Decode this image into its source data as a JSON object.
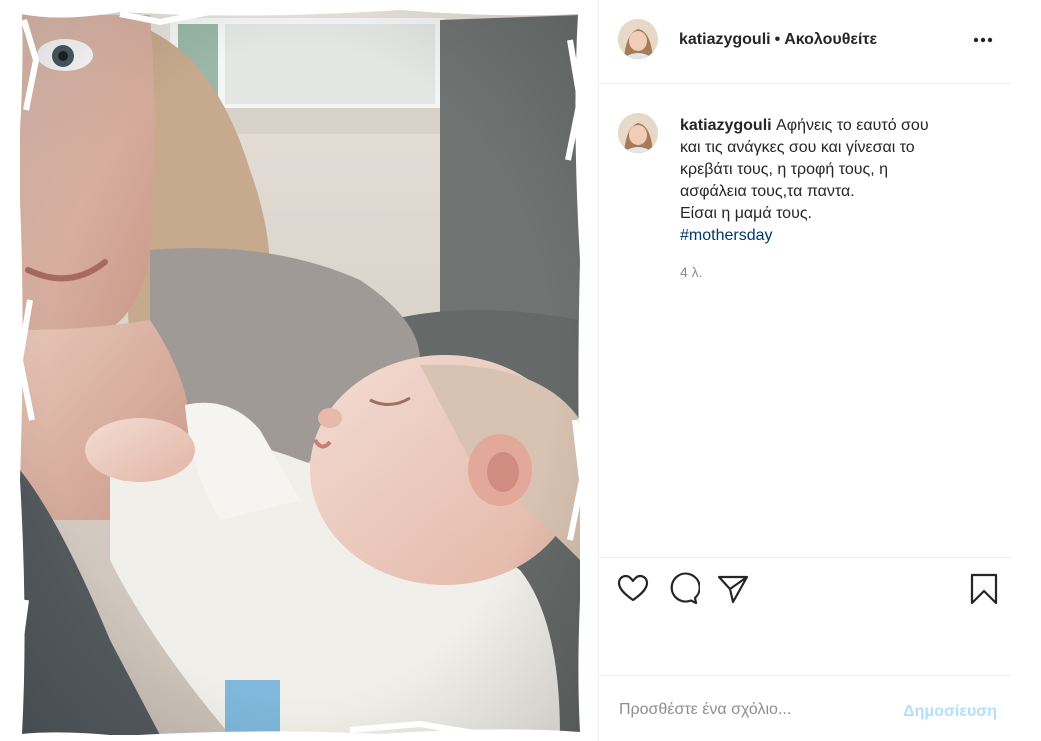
{
  "header": {
    "username": "katiazygouli",
    "separator": "•",
    "follow_label": "Ακολουθείτε",
    "more_icon": "more-horizontal-icon"
  },
  "caption": {
    "username": "katiazygouli",
    "first_line": "Αφήνεις το εαυτό σου",
    "lines": [
      "και τις ανάγκες σου και γίνεσαι το",
      "κρεβάτι τους, η τροφή τους, η",
      "ασφάλεια τους,τα παντα.",
      "Είσαι η μαμά τους."
    ],
    "hashtag": "#mothersday",
    "time": "4 λ."
  },
  "actions": {
    "like_icon": "heart-icon",
    "comment_icon": "comment-icon",
    "share_icon": "paper-plane-icon",
    "save_icon": "bookmark-icon"
  },
  "comment": {
    "placeholder": "Προσθέστε ένα σχόλιο...",
    "publish_label": "Δημοσίευση"
  },
  "colors": {
    "text": "#262626",
    "muted": "#8e8e8e",
    "hashtag": "#00376b",
    "publish_disabled": "#b2dffc",
    "divider": "#efefef"
  }
}
